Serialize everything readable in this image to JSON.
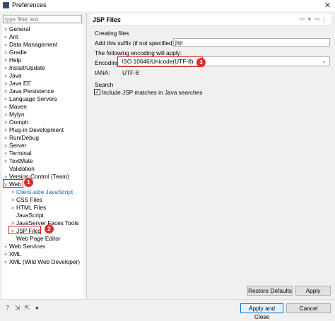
{
  "window": {
    "title": "Preferences"
  },
  "filter": {
    "placeholder": "type filter text"
  },
  "tree": {
    "items": [
      {
        "label": "General",
        "arrow": ">"
      },
      {
        "label": "Ant",
        "arrow": ">"
      },
      {
        "label": "Data Management",
        "arrow": ">"
      },
      {
        "label": "Gradle",
        "arrow": ">"
      },
      {
        "label": "Help",
        "arrow": ">"
      },
      {
        "label": "Install/Update",
        "arrow": ">"
      },
      {
        "label": "Java",
        "arrow": ">"
      },
      {
        "label": "Java EE",
        "arrow": ">"
      },
      {
        "label": "Java Persistence",
        "arrow": ">"
      },
      {
        "label": "Language Servers",
        "arrow": ">"
      },
      {
        "label": "Maven",
        "arrow": ">"
      },
      {
        "label": "Mylyn",
        "arrow": ">"
      },
      {
        "label": "Oomph",
        "arrow": ">"
      },
      {
        "label": "Plug-in Development",
        "arrow": ">"
      },
      {
        "label": "Run/Debug",
        "arrow": ">"
      },
      {
        "label": "Server",
        "arrow": ">"
      },
      {
        "label": "Terminal",
        "arrow": ">"
      },
      {
        "label": "TextMate",
        "arrow": ">"
      },
      {
        "label": "Validation",
        "arrow": ""
      },
      {
        "label": "Version Control (Team)",
        "arrow": ">"
      },
      {
        "label": "Web",
        "arrow": "v"
      },
      {
        "label": "Client-side JavaScript",
        "arrow": ">"
      },
      {
        "label": "CSS Files",
        "arrow": ">"
      },
      {
        "label": "HTML Files",
        "arrow": ">"
      },
      {
        "label": "JavaScript",
        "arrow": ""
      },
      {
        "label": "JavaServer Faces Tools",
        "arrow": ">"
      },
      {
        "label": "JSP Files",
        "arrow": ">"
      },
      {
        "label": "Web Page Editor",
        "arrow": ""
      },
      {
        "label": "Web Services",
        "arrow": ">"
      },
      {
        "label": "XML",
        "arrow": ">"
      },
      {
        "label": "XML (Wild Web Developer)",
        "arrow": ">"
      }
    ]
  },
  "page": {
    "title": "JSP Files",
    "creating_files": "Creating files",
    "suffix_label": "Add this suffix (if not specified):",
    "suffix_value": "jsp",
    "encoding_heading": "The following encoding will apply:",
    "encoding_label": "Encoding:",
    "encoding_value": "ISO 10646/Unicode(UTF-8)",
    "iana_label": "IANA:",
    "iana_value": "UTF-8",
    "search_heading": "Search",
    "include_jsp_label": "Include JSP matches in Java searches",
    "include_jsp_checked": true
  },
  "annotations": {
    "badge1": "1",
    "badge2": "2",
    "badge3": "3"
  },
  "buttons": {
    "restore_defaults": "Restore Defaults",
    "apply": "Apply",
    "apply_close": "Apply and Close",
    "cancel": "Cancel"
  },
  "colors": {
    "highlight": "#e02020",
    "badge": "#d9302c",
    "selection_text": "#1a5fb4"
  }
}
